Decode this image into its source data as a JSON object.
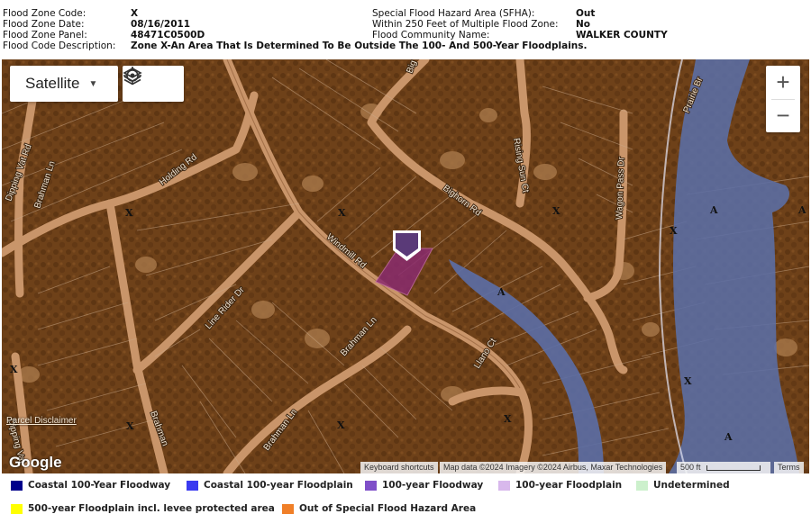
{
  "info": {
    "flood_zone_code_label": "Flood Zone Code:",
    "flood_zone_code": "X",
    "flood_zone_date_label": "Flood Zone Date:",
    "flood_zone_date": "08/16/2011",
    "flood_zone_panel_label": "Flood Zone Panel:",
    "flood_zone_panel": "48471C0500D",
    "flood_code_description_label": "Flood Code Description:",
    "flood_code_description": "Zone X-An Area That Is Determined To Be Outside The 100- And 500-Year Floodplains.",
    "sfha_label": "Special Flood Hazard Area (SFHA):",
    "sfha": "Out",
    "multiple_zone_label": "Within 250 Feet of Multiple Flood Zone:",
    "multiple_zone": "No",
    "community_label": "Flood Community Name:",
    "community": "WALKER COUNTY"
  },
  "map": {
    "map_type": "Satellite",
    "zoom_in": "+",
    "zoom_out": "−",
    "google": "Google",
    "parcel_disclaimer": "Parcel Disclaimer",
    "keyboard_shortcuts": "Keyboard shortcuts",
    "map_data": "Map data ©2024 Imagery ©2024 Airbus, Maxar Technologies",
    "scale": "500 ft",
    "terms": "Terms",
    "roads": {
      "bighorn": "Bighorn Rd",
      "big": "Big",
      "windmill": "Windmill Rd",
      "holding": "Holding Rd",
      "brahman_ln_1": "Brahman Ln",
      "brahman_ln_2": "Brahman Ln",
      "brahman_ln_3": "Brahman Ln",
      "brahman_ln_4": "Brahman",
      "dipping_vat": "Dipping Vat Rd",
      "dipping_vat_2": "Dipping Vat",
      "line_rider": "Line Rider Dr",
      "rising_sun": "Rising Sun Ct",
      "wagon_pass": "Wagon Pass Dr",
      "llano": "Llano Ct",
      "prairie": "Prairie Br"
    },
    "zone_labels": [
      "X",
      "X",
      "X",
      "X",
      "X",
      "X",
      "X",
      "X",
      "X",
      "A",
      "A",
      "A",
      "A"
    ],
    "colors": {
      "zone_x_overlay": "#7a4516",
      "zone_a_fill": "#5b6ea6",
      "parcel_highlight": "#8a2b6e",
      "marker": "#5a3a78",
      "road": "#c9956a"
    }
  },
  "legend": [
    {
      "label": "Coastal 100-Year Floodway",
      "color": "#00008b"
    },
    {
      "label": "Coastal 100-year Floodplain",
      "color": "#3a3af0"
    },
    {
      "label": "100-year Floodway",
      "color": "#7f4fc9"
    },
    {
      "label": "100-year Floodplain",
      "color": "#d8b8ec"
    },
    {
      "label": "Undetermined",
      "color": "#ccf0cc"
    },
    {
      "label": "500-year Floodplain incl. levee protected area",
      "color": "#ffff00"
    },
    {
      "label": "Out of Special Flood Hazard Area",
      "color": "#f07f28"
    }
  ]
}
